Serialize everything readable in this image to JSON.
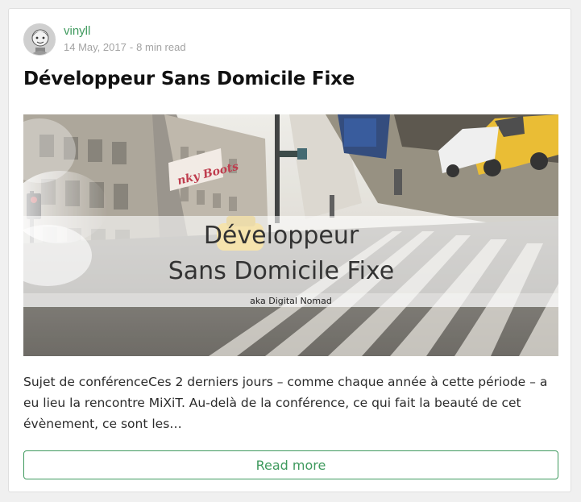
{
  "post": {
    "author": "vinyll",
    "date": "14 May, 2017",
    "read_time": "8 min read",
    "title": "Développeur Sans Domicile Fixe",
    "hero_image": {
      "title_line_1": "Développeur",
      "title_line_2": "Sans Domicile Fixe",
      "tagline": "aka Digital Nomad",
      "sign_text": "nky Boots"
    },
    "excerpt": "Sujet de conférenceCes 2 derniers jours – comme chaque année à cette période – a eu lieu la rencontre MiXiT. Au-delà de la conférence, ce qui fait la beauté de cet évènement, ce sont les…",
    "read_more_label": "Read more"
  },
  "colors": {
    "accent": "#3f9a5e",
    "title": "#111111",
    "meta": "#a3a3a3",
    "taxi": "#e8b61f"
  },
  "icons": {
    "avatar": "avatar-illustration"
  }
}
